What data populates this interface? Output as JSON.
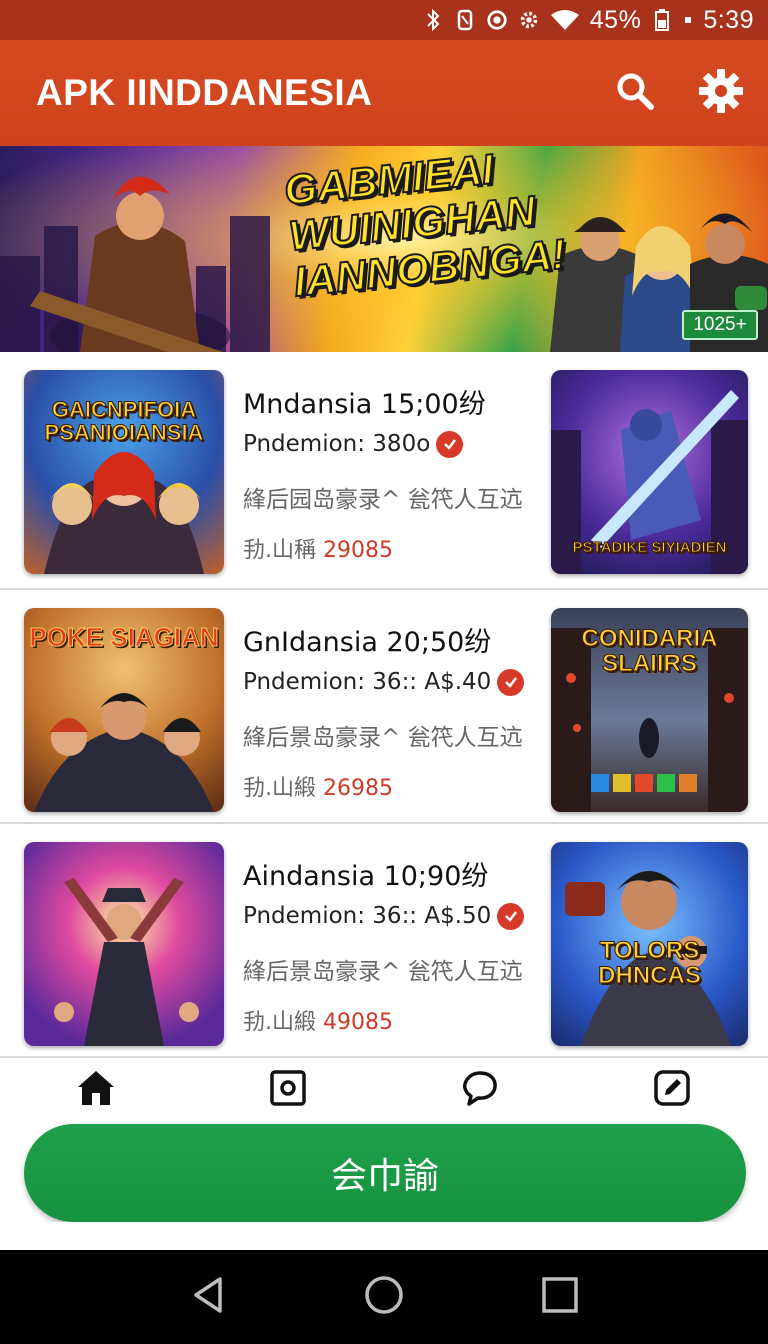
{
  "status_bar": {
    "battery": "45%",
    "time": "5:39",
    "icons": [
      "bluetooth-icon",
      "nfc-icon",
      "sync-icon",
      "gear-icon",
      "wifi-icon",
      "battery-icon",
      "dot-icon"
    ]
  },
  "app_bar": {
    "title": "APK IINDDANESIA",
    "actions": [
      "search-icon",
      "settings-icon"
    ]
  },
  "banner": {
    "headline": [
      "GABMIEAI",
      "WUINIGHAN",
      "IANNOBNGA!"
    ],
    "badge": "1025+"
  },
  "games": [
    {
      "name": "Mndansia 15;00纷",
      "price": "Pndemion: 380o",
      "desc": "綘后园岛豪录^ 瓮笩人互迒",
      "meta_label": "劧.山稱",
      "meta_value": "29085",
      "thumb_left_title": "GAICNPIFOIA PSANIOIANSIA",
      "thumb_right_title": "PSTADIKE SIYIADIEN",
      "thumb_left_colors": [
        "#2a4fa8",
        "#e07a2a"
      ],
      "thumb_right_colors": [
        "#3a2a8a",
        "#8a3ab0"
      ]
    },
    {
      "name": "GnIdansia 20;50纷",
      "price": "Pndemion: 36:: A$.40",
      "desc": "綘后景岛豪录^ 瓮笩人互迒",
      "meta_label": "劧.山緞",
      "meta_value": "26985",
      "thumb_left_title": "POKE SIAGIAN",
      "thumb_right_title": "CONIDARIA SLAIIRS",
      "thumb_left_colors": [
        "#a85a2a",
        "#e0a040"
      ],
      "thumb_right_colors": [
        "#2a3048",
        "#5a6a88"
      ]
    },
    {
      "name": "Aindansia 10;90纷",
      "price": "Pndemion: 36:: A$.50",
      "desc": "綘后景岛豪录^ 瓮笩人互迒",
      "meta_label": "劧.山緞",
      "meta_value": "49085",
      "thumb_left_title": "",
      "thumb_right_title": "TOLORS DHNCAS",
      "thumb_left_colors": [
        "#6a2a9a",
        "#e04aa0"
      ],
      "thumb_right_colors": [
        "#2a58c8",
        "#4a9ae8"
      ]
    }
  ],
  "bottom_nav": [
    "home-icon",
    "camera-icon",
    "chat-icon",
    "edit-icon"
  ],
  "cta_label": "会巾諭",
  "system_nav": [
    "back-icon",
    "home-circle-icon",
    "recents-icon"
  ],
  "colors": {
    "app_bar": "#cf421d",
    "status_bar": "#a8321c",
    "cta": "#1a9a44",
    "accent_red": "#d03a26"
  }
}
